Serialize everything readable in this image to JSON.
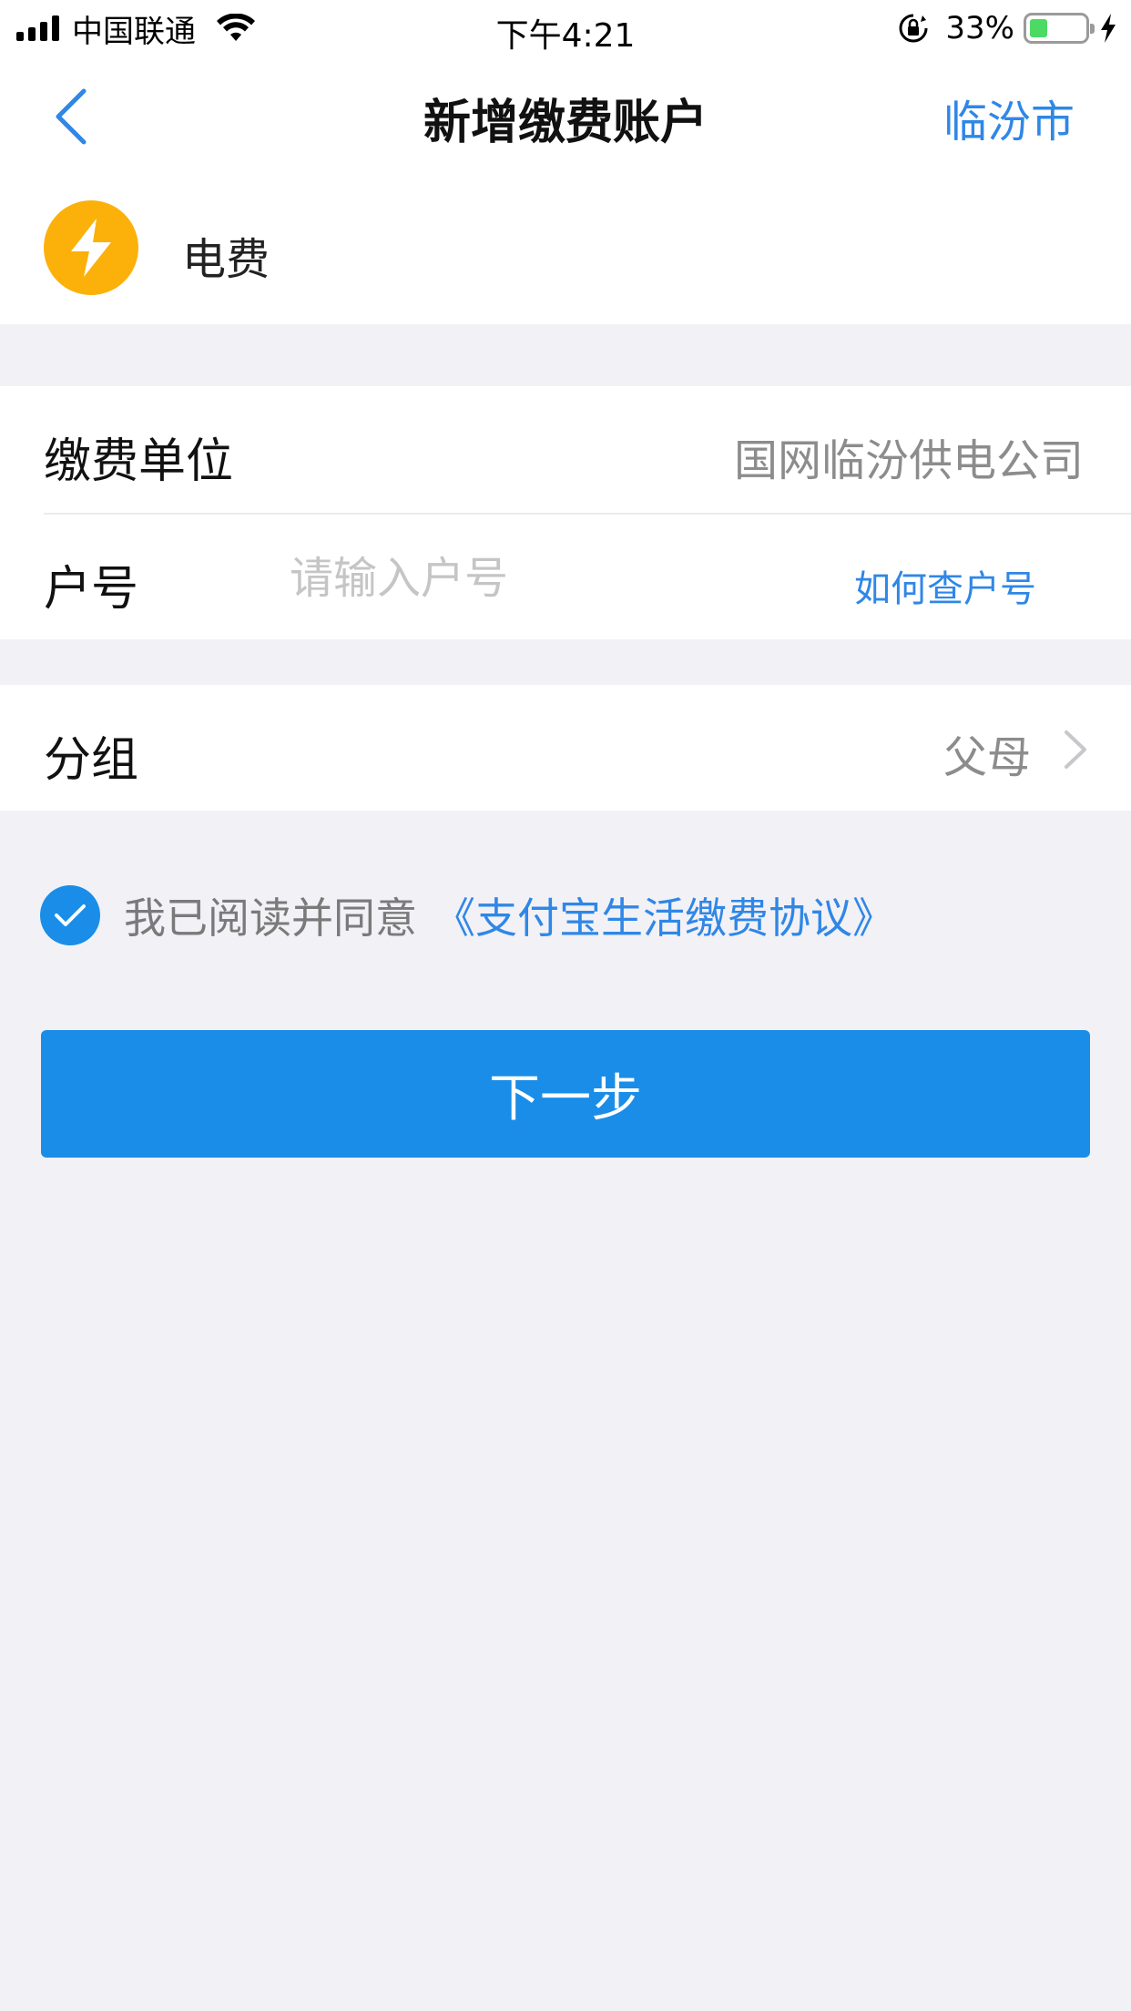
{
  "status_bar": {
    "carrier": "中国联通",
    "time": "下午4:21",
    "battery_percent": "33%",
    "battery_level": 0.33,
    "icons": [
      "signal-icon",
      "wifi-icon",
      "rotation-lock-icon",
      "battery-icon",
      "charging-icon"
    ]
  },
  "nav": {
    "back_icon": "chevron-left-icon",
    "title": "新增缴费账户",
    "city": "临汾市"
  },
  "service": {
    "icon": "lightning-icon",
    "name": "电费"
  },
  "form": {
    "unit_label": "缴费单位",
    "unit_value": "国网临汾供电公司",
    "account_label": "户号",
    "account_placeholder": "请输入户号",
    "account_value": "",
    "help_link": "如何查户号",
    "group_label": "分组",
    "group_value": "父母"
  },
  "agreement": {
    "checked": true,
    "text": "我已阅读并同意",
    "link": "《支付宝生活缴费协议》"
  },
  "next_button": "下一步",
  "colors": {
    "accent": "#2f87e6",
    "button": "#1a8de8",
    "service_icon_bg": "#fbb10a",
    "background": "#f2f1f6"
  }
}
